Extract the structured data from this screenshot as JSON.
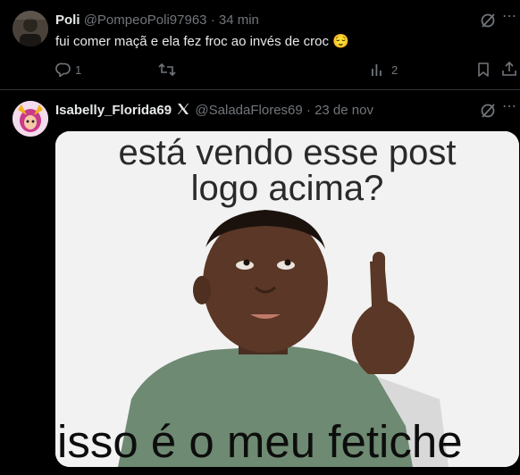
{
  "tweet1": {
    "display_name": "Poli",
    "handle": "@PompeoPoli97963",
    "separator": "·",
    "time": "34 min",
    "text": "fui comer maçã e ela fez froc ao invés de croc",
    "emoji": "😌",
    "reply_count": "1",
    "views_count": "2"
  },
  "tweet2": {
    "display_name": "Isabelly_Florida69",
    "handle": "@SaladaFlores69",
    "separator": "·",
    "date": "23 de nov",
    "meme_top_line1": "está vendo esse post",
    "meme_top_line2": "logo acima?",
    "meme_bottom": "isso é o meu fetiche"
  },
  "icons": {
    "grok": "grok-icon",
    "reply": "reply-icon",
    "retweet": "retweet-icon",
    "views": "views-icon",
    "bookmark": "bookmark-icon",
    "share": "share-icon",
    "affiliate": "x-affiliate-badge"
  }
}
